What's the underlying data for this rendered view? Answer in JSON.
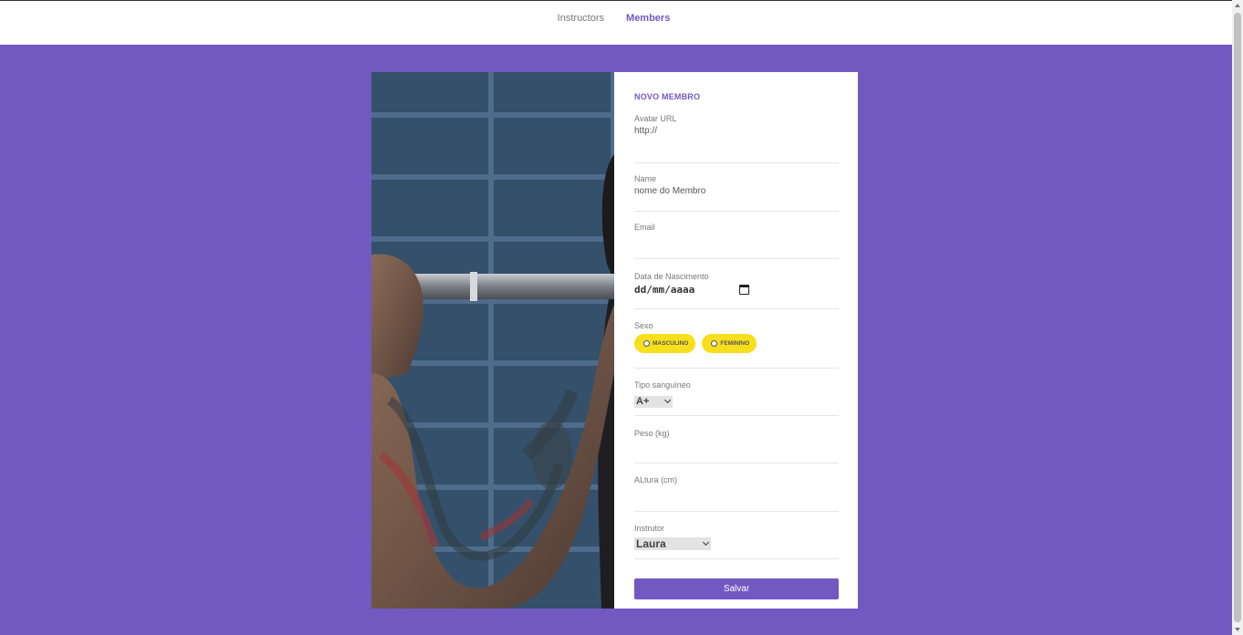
{
  "nav": {
    "instructors": "Instructors",
    "members": "Members"
  },
  "form": {
    "title": "NOVO MEMBRO",
    "avatar": {
      "label": "Avatar URL",
      "placeholder": "http://"
    },
    "name": {
      "label": "Name",
      "placeholder": "nome do Membro"
    },
    "email": {
      "label": "Email",
      "value": ""
    },
    "birth": {
      "label": "Data de Nascimento",
      "placeholder": "dd/mm/aaaa"
    },
    "sexo": {
      "label": "Sexo",
      "options": [
        "MASCULINO",
        "FEMININO"
      ]
    },
    "blood": {
      "label": "Tipo sanguíneo",
      "selected": "A+"
    },
    "weight": {
      "label": "Peso (kg)",
      "value": ""
    },
    "height": {
      "label": "ALtura (cm)",
      "value": ""
    },
    "instructor": {
      "label": "Instrutor",
      "selected": "Laura"
    },
    "submit": "Salvar"
  },
  "colors": {
    "brand": "#7159c1",
    "pill": "#f7df1e"
  }
}
